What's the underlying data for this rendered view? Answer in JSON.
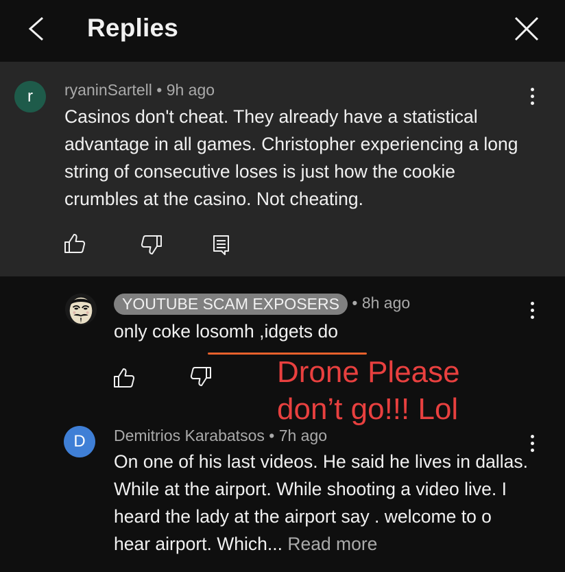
{
  "header": {
    "title": "Replies"
  },
  "parent_comment": {
    "avatar_letter": "r",
    "author": "ryaninSartell",
    "time": "9h ago",
    "text": "Casinos don't cheat. They already have a statistical advantage in all games. Christopher experiencing a long string of consecutive loses is just how the cookie crumbles at the casino. Not cheating."
  },
  "replies": [
    {
      "author": "YOUTUBE SCAM EXPOSERS",
      "time": "8h ago",
      "text": "only coke losomh ,idgets do"
    },
    {
      "avatar_letter": "D",
      "author": "Demitrios Karabatsos",
      "time": "7h ago",
      "text": "On one of his last videos. He said he lives in dallas.  While at the airport. While shooting a video live.  I heard the lady at the airport say . welcome to o hear airport. Which...",
      "read_more": "Read more"
    }
  ],
  "annotation": {
    "line1": "Drone Please",
    "line2": "don’t go!!! Lol"
  },
  "separator": "•",
  "colors": {
    "background": "#0f0f0f",
    "parent_background": "#272727",
    "avatar_r": "#1e5b4a",
    "avatar_d": "#3f7fd6",
    "annotation_red": "#e8403f",
    "underline_orange": "#e8612c"
  },
  "icons": [
    "chevron-left-icon",
    "close-icon",
    "kebab-menu-icon",
    "thumb-up-icon",
    "thumb-down-icon",
    "reply-comment-icon",
    "guy-fawkes-mask-avatar"
  ]
}
